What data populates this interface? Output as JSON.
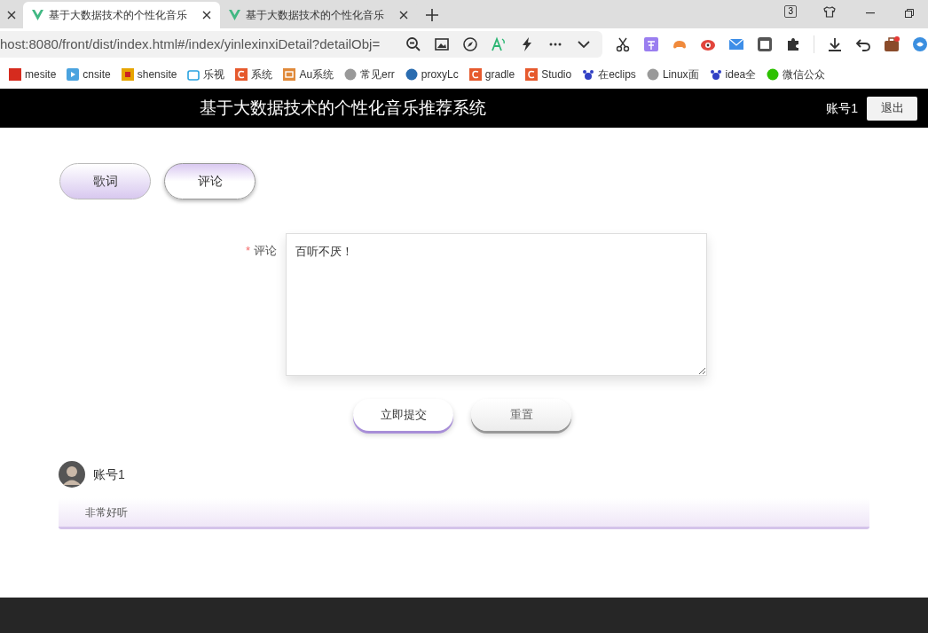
{
  "browser": {
    "tabs": [
      {
        "title": "基于大数据技术的个性化音乐",
        "selected": true
      },
      {
        "title": "基于大数据技术的个性化音乐",
        "selected": false
      }
    ],
    "tab_count": "3",
    "address": "host:8080/front/dist/index.html#/index/yinlexinxiDetail?detailObj=",
    "bookmarks": [
      "mesite",
      "cnsite",
      "shensite",
      "乐视",
      "系统",
      "Au系统",
      "常见err",
      "proxyLc",
      "gradle",
      "Studio",
      "在eclips",
      "Linux面",
      "idea全",
      "微信公众"
    ]
  },
  "header": {
    "title": "基于大数据技术的个性化音乐推荐系统",
    "user": "账号1",
    "logout": "退出"
  },
  "tabs": [
    {
      "label": "歌词",
      "selected": false
    },
    {
      "label": "评论",
      "selected": true
    }
  ],
  "form": {
    "label": "评论",
    "required_mark": "*",
    "value": "百听不厌！",
    "submit": "立即提交",
    "reset": "重置"
  },
  "comments": [
    {
      "user": "账号1",
      "text": "非常好听"
    }
  ]
}
